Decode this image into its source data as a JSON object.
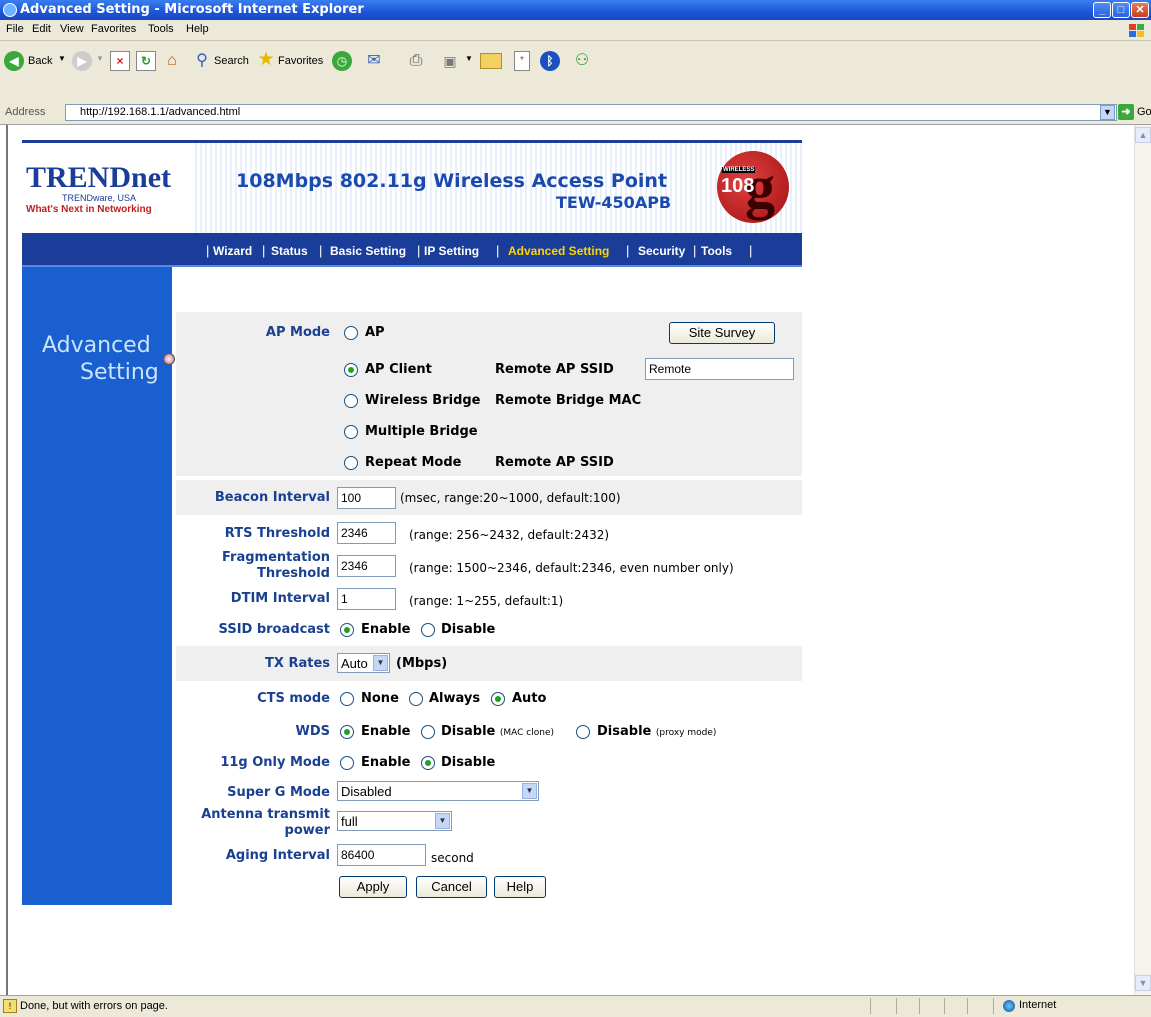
{
  "window": {
    "title": "Advanced Setting - Microsoft Internet Explorer"
  },
  "menu": [
    "File",
    "Edit",
    "View",
    "Favorites",
    "Tools",
    "Help"
  ],
  "toolbar": {
    "back": "Back",
    "search": "Search",
    "favorites": "Favorites"
  },
  "address": {
    "label": "Address",
    "url": "http://192.168.1.1/advanced.html",
    "go": "Go"
  },
  "banner": {
    "logo": "TRENDnet",
    "logo_sub": "TRENDware, USA",
    "tagline": "What's Next in Networking",
    "title": "108Mbps 802.11g Wireless Access Point",
    "model": "TEW-450APB",
    "badge_wireless": "WIRELESS",
    "badge_number": "108",
    "badge_letter": "g"
  },
  "nav": [
    "Wizard",
    "Status",
    "Basic Setting",
    "IP Setting",
    "Advanced Setting",
    "Security",
    "Tools"
  ],
  "sidebar": {
    "title_line1": "Advanced",
    "title_line2": "Setting"
  },
  "form": {
    "ap_mode": {
      "label": "AP Mode",
      "options": [
        "AP",
        "AP Client",
        "Wireless Bridge",
        "Multiple Bridge",
        "Repeat Mode"
      ],
      "selected": "AP Client",
      "site_survey": "Site Survey",
      "remote_ap_ssid_label": "Remote AP SSID",
      "remote_ap_ssid_value": "Remote",
      "remote_bridge_mac_label": "Remote Bridge MAC",
      "repeat_ssid_label": "Remote AP SSID"
    },
    "beacon": {
      "label": "Beacon Interval",
      "value": "100",
      "hint": "(msec, range:20~1000, default:100)"
    },
    "rts": {
      "label": "RTS Threshold",
      "value": "2346",
      "hint": "(range: 256~2432, default:2432)"
    },
    "frag": {
      "label_line1": "Fragmentation",
      "label_line2": "Threshold",
      "value": "2346",
      "hint": "(range: 1500~2346, default:2346, even number only)"
    },
    "dtim": {
      "label": "DTIM Interval",
      "value": "1",
      "hint": "(range: 1~255, default:1)"
    },
    "ssid_broadcast": {
      "label": "SSID broadcast",
      "enable": "Enable",
      "disable": "Disable",
      "selected": "Enable"
    },
    "tx_rates": {
      "label": "TX Rates",
      "value": "Auto",
      "unit": "(Mbps)"
    },
    "cts": {
      "label": "CTS mode",
      "none": "None",
      "always": "Always",
      "auto": "Auto",
      "selected": "Auto"
    },
    "wds": {
      "label": "WDS",
      "enable": "Enable",
      "disable1": "Disable",
      "disable1_note": "(MAC clone)",
      "disable2": "Disable",
      "disable2_note": "(proxy mode)",
      "selected": "Enable"
    },
    "g_only": {
      "label": "11g Only Mode",
      "enable": "Enable",
      "disable": "Disable",
      "selected": "Disable"
    },
    "super_g": {
      "label": "Super G Mode",
      "value": "Disabled"
    },
    "antenna": {
      "label_line1": "Antenna transmit",
      "label_line2": "power",
      "value": "full"
    },
    "aging": {
      "label": "Aging Interval",
      "value": "86400",
      "unit": "second"
    },
    "buttons": {
      "apply": "Apply",
      "cancel": "Cancel",
      "help": "Help"
    }
  },
  "status": {
    "text": "Done, but with errors on page.",
    "zone": "Internet"
  }
}
